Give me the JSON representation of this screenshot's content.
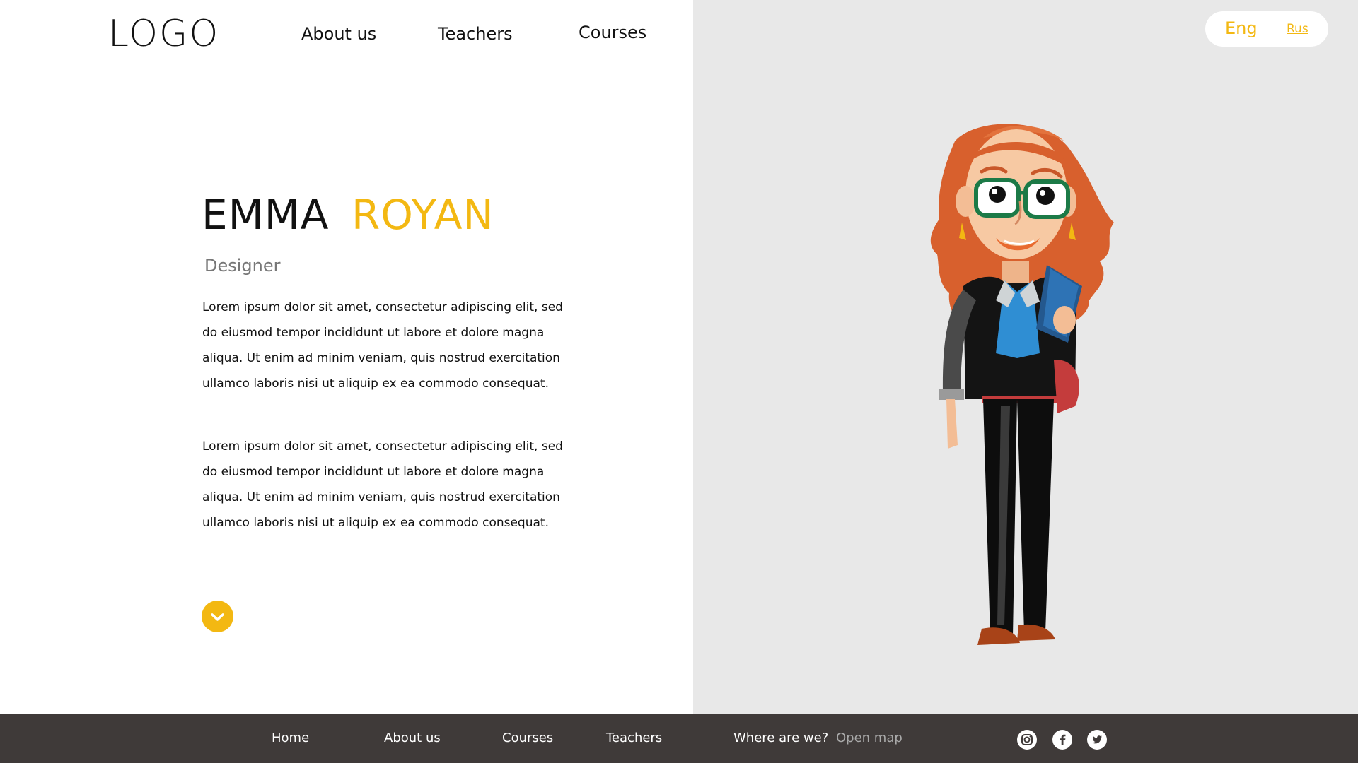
{
  "header": {
    "logo": "LOGO",
    "nav": [
      "About us",
      "Teachers",
      "Courses"
    ]
  },
  "language": {
    "active": "Eng",
    "alternate": "Rus"
  },
  "profile": {
    "first_name": "EMMA",
    "last_name": "ROYAN",
    "role": "Designer",
    "paragraphs": [
      "Lorem ipsum dolor sit amet, consectetur adipiscing elit, sed  do eiusmod tempor incididunt  ut labore  et dolore magna aliqua. Ut enim ad minim veniam, quis nostrud exercitation ullamco laboris nisi ut  aliquip ex ea commodo consequat.",
      "Lorem ipsum dolor sit amet, consectetur adipiscing elit, sed  do eiusmod tempor incididunt  ut labore  et dolore magna aliqua. Ut enim ad minim veniam, quis nostrud exercitation ullamco laboris nisi ut  aliquip ex ea commodo consequat."
    ]
  },
  "footer": {
    "links": [
      "Home",
      "About  us",
      "Courses",
      "Teachers"
    ],
    "location_label": "Where are we?",
    "map_link": "Open map",
    "social_icons": [
      "instagram-icon",
      "facebook-icon",
      "twitter-icon"
    ]
  },
  "colors": {
    "accent": "#f3b812",
    "right_panel_bg": "#e8e8e8",
    "footer_bg": "#3f3a39",
    "map_link": "#a9a9a9"
  }
}
